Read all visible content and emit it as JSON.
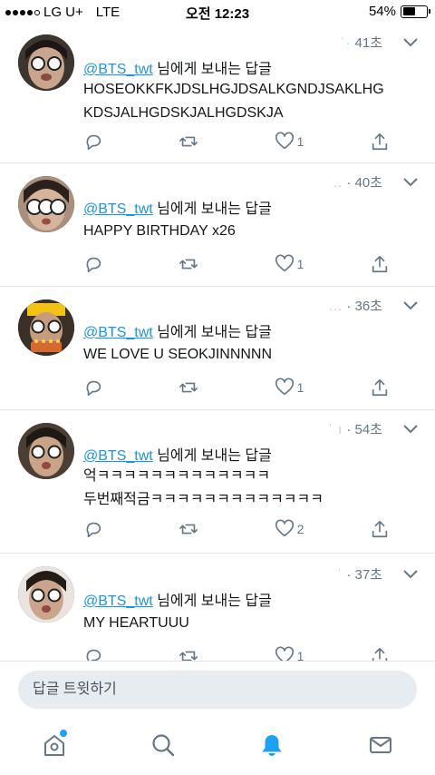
{
  "status_bar": {
    "carrier": "LG U+",
    "network": "LTE",
    "time": "오전 12:23",
    "battery_pct": "54%",
    "battery_level": 0.54,
    "signal_bars_filled": 4
  },
  "colors": {
    "link": "#1b95e0",
    "accent": "#1da1f2",
    "secondary_text": "#657786"
  },
  "tweets": [
    {
      "time_ago": "41초",
      "reply_handle": "@BTS_twt",
      "reply_suffix": " 님에게 보내는 답글",
      "text": "HOSEOKKFKJDSLHGJDSALKGNDJSAKLHG\nKDSJALHGDSKJALHGDSKJA",
      "like_count": "1",
      "reply_count": "",
      "retweet_count": ""
    },
    {
      "time_ago": "40초",
      "reply_handle": "@BTS_twt",
      "reply_suffix": " 님에게 보내는 답글",
      "text": "HAPPY BIRTHDAY x26",
      "like_count": "1",
      "reply_count": "",
      "retweet_count": ""
    },
    {
      "time_ago": "36초",
      "reply_handle": "@BTS_twt",
      "reply_suffix": " 님에게 보내는 답글",
      "text": "WE LOVE U SEOKJINNNNN",
      "like_count": "1",
      "reply_count": "",
      "retweet_count": ""
    },
    {
      "time_ago": "54초",
      "reply_handle": "@BTS_twt",
      "reply_suffix": " 님에게 보내는 답글",
      "text": "억ㅋㅋㅋㅋㅋㅋㅋㅋㅋㅋㅋㅋㅋ\n두번째적금ㅋㅋㅋㅋㅋㅋㅋㅋㅋㅋㅋㅋㅋ",
      "like_count": "2",
      "reply_count": "",
      "retweet_count": ""
    },
    {
      "time_ago": "37초",
      "reply_handle": "@BTS_twt",
      "reply_suffix": " 님에게 보내는 답글",
      "text": "MY HEARTUUU",
      "like_count": "1",
      "reply_count": "",
      "retweet_count": ""
    }
  ],
  "reply_bar": {
    "placeholder": "답글 트윗하기"
  },
  "tab_bar": {
    "items": [
      {
        "icon": "home-icon",
        "has_badge": true
      },
      {
        "icon": "search-icon",
        "has_badge": false
      },
      {
        "icon": "notifications-icon",
        "active": true
      },
      {
        "icon": "messages-icon",
        "has_badge": false
      }
    ]
  }
}
